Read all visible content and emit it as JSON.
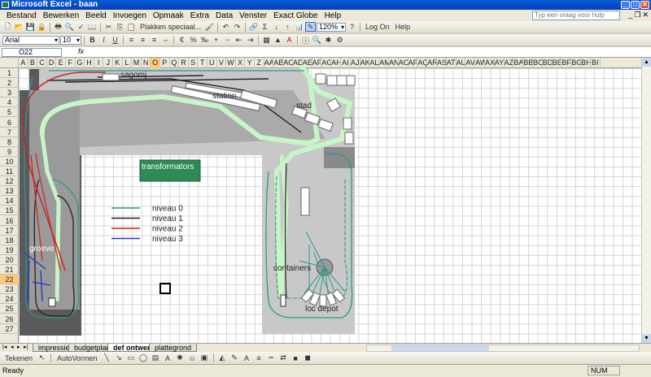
{
  "window": {
    "title": "Microsoft Excel - baan"
  },
  "menu": [
    "Bestand",
    "Bewerken",
    "Beeld",
    "Invoegen",
    "Opmaak",
    "Extra",
    "Data",
    "Venster",
    "Exact Globe",
    "Help"
  ],
  "help_placeholder": "Typ een vraag voor hulp",
  "toolbar1": {
    "paste_special": "Plakken speciaal...",
    "zoom": "120%",
    "logon": "Log On",
    "help": "Help"
  },
  "toolbar2": {
    "font": "Arial",
    "size": "10"
  },
  "namebox": "O22",
  "fx": "fx",
  "columns": [
    "A",
    "B",
    "C",
    "D",
    "E",
    "F",
    "G",
    "H",
    "I",
    "J",
    "K",
    "L",
    "M",
    "N",
    "O",
    "P",
    "Q",
    "R",
    "S",
    "T",
    "U",
    "V",
    "W",
    "X",
    "Y",
    "Z",
    "AA",
    "AB",
    "AC",
    "AD",
    "AE",
    "AF",
    "AG",
    "AH",
    "AI",
    "AJ",
    "AK",
    "AL",
    "AM",
    "AN",
    "AO",
    "AP",
    "AQ",
    "AR",
    "AS",
    "AT",
    "AU",
    "AV",
    "AW",
    "AX",
    "AY",
    "AZ",
    "BA",
    "BB",
    "BC",
    "BD",
    "BE",
    "BF",
    "BG",
    "BH",
    "BI"
  ],
  "selected_column": "O",
  "rows": [
    "1",
    "2",
    "3",
    "4",
    "5",
    "6",
    "7",
    "8",
    "9",
    "10",
    "11",
    "12",
    "13",
    "14",
    "15",
    "16",
    "17",
    "18",
    "19",
    "20",
    "21",
    "22",
    "23",
    "24",
    "25",
    "26",
    "27"
  ],
  "selected_row": "22",
  "drawing": {
    "labels": {
      "sagomj": "sagomj",
      "station": "station",
      "stad": "stad",
      "transformators": "transformators",
      "groeve": "groeve",
      "containers": "containers",
      "loc_depot": "loc depot"
    },
    "legend": [
      {
        "label": "niveau 0",
        "color": "#2a9a8a"
      },
      {
        "label": "niveau 1",
        "color": "#222222"
      },
      {
        "label": "niveau 2",
        "color": "#cc2222"
      },
      {
        "label": "niveau 3",
        "color": "#2233cc"
      }
    ],
    "colors": {
      "baseboard_dark": "#5a5a5a",
      "baseboard_mid": "#9a9a9a",
      "baseboard_light": "#c8c8c8",
      "path": "#c8f5c8",
      "box_green": "#2e8b57"
    }
  },
  "sheets": [
    "impressies",
    "budgetplan",
    "def ontwerp",
    "plattegrond"
  ],
  "active_sheet": "def ontwerp",
  "drawbar": {
    "tekenen": "Tekenen",
    "autovormen": "AutoVormen"
  },
  "status": {
    "left": "Ready",
    "num": "NUM"
  }
}
